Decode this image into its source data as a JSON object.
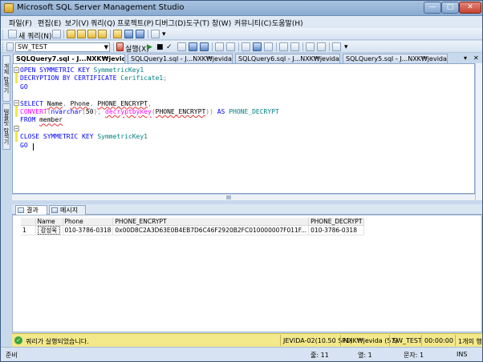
{
  "window": {
    "title": "Microsoft SQL Server Management Studio"
  },
  "menu": [
    "파일(F)",
    "편집(E)",
    "보기(V)",
    "쿼리(Q)",
    "프로젝트(P)",
    "디버그(D)",
    "도구(T)",
    "창(W)",
    "커뮤니티(C)",
    "도움말(H)"
  ],
  "toolbar1": {
    "new_query_label": "새 쿼리(N)"
  },
  "toolbar2": {
    "database": "SW_TEST",
    "execute_label": "실행(X)"
  },
  "left_tabs": [
    "개체 탐색기",
    "템플릿 탐색기"
  ],
  "doc_tabs": [
    "SQLQuery7.sql - J...NXK₩jevida (57))*",
    "SQLQuery1.sql - J...NXK₩jevida (52))*",
    "SQLQuery6.sql - J...NXK₩jevida (62))*",
    "SQLQuery5.sql - J...NXK₩jevida (60))*"
  ],
  "code": {
    "l1_kw": "OPEN SYMMETRIC KEY",
    "l1_id": "SymmetricKey1",
    "l2_kw": "DECRYPTION BY CERTIFICATE",
    "l2_id": "Cerificate1",
    "l2_end": ";",
    "l3": "GO",
    "l5_kw": "SELECT",
    "l5_a": "Name",
    "l5_b": "Phone",
    "l5_c": "PHONE_ENCRYPT",
    "l6_fn": "CONVERT",
    "l6_type": "nvarchar",
    "l6_n": "50",
    "l6_fn2": "decryptbykey",
    "l6_arg": "PHONE_ENCRYPT",
    "l6_as": "AS",
    "l6_alias": "PHONE_DECRYPT",
    "l7_kw": "FROM",
    "l7_tbl": "member",
    "l9_kw": "CLOSE SYMMETRIC KEY",
    "l9_id": "SymmetricKey1",
    "l10": "GO"
  },
  "result_tabs": [
    "결과",
    "메시지"
  ],
  "grid": {
    "columns": [
      "Name",
      "Phone",
      "PHONE_ENCRYPT",
      "PHONE_DECRYPT"
    ],
    "rows": [
      {
        "num": "1",
        "name": "강성욱",
        "phone": "010-3786-0318",
        "encrypt": "0x00D8C2A3D63E0B4EB7D6C46F2920B2FC010000007F011F...",
        "decrypt": "010-3786-0318"
      }
    ]
  },
  "query_status": {
    "message": "쿼리가 실행되었습니다.",
    "server": "JEVIDA-02(10.50 SP1)",
    "user": "NXK₩jevida (57)",
    "database": "SW_TEST",
    "elapsed": "00:00:00",
    "rows": "1개의 행"
  },
  "statusbar": {
    "ready": "준비",
    "line": "줄: 11",
    "col": "열: 1",
    "ch": "문자: 1",
    "mode": "INS"
  }
}
